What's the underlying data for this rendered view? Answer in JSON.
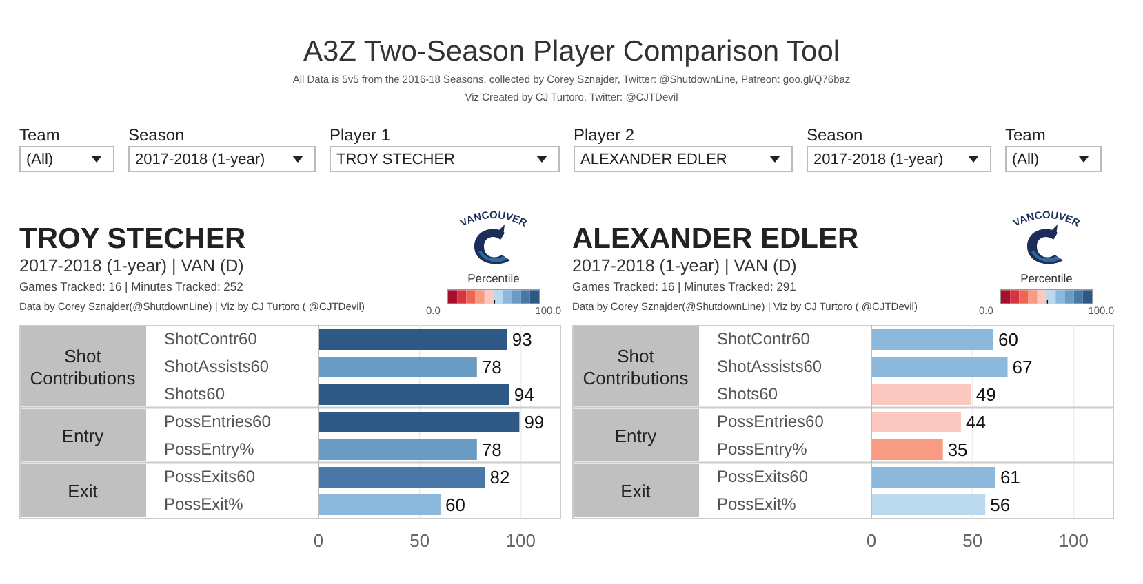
{
  "title": "A3Z Two-Season Player Comparison Tool",
  "subtitle_lines": [
    "All Data is 5v5 from the 2016-18 Seasons, collected by Corey Sznajder, Twitter: @ShutdownLine, Patreon: goo.gl/Q76baz",
    "Viz Created by CJ Turtoro, Twitter: @CJTDevil"
  ],
  "filters": [
    {
      "label": "Team",
      "value": "(All)"
    },
    {
      "label": "Season",
      "value": "2017-2018 (1-year)"
    },
    {
      "label": "Player 1",
      "value": "TROY STECHER"
    },
    {
      "label": "Player 2",
      "value": "ALEXANDER EDLER"
    },
    {
      "label": "Season",
      "value": "2017-2018 (1-year)"
    },
    {
      "label": "Team",
      "value": "(All)"
    }
  ],
  "panels": [
    {
      "player": "TROY STECHER",
      "season_team": "2017-2018 (1-year) | VAN (D)",
      "tracked": "Games Tracked: 16  | Minutes Tracked: 252",
      "credit": "Data by Corey Sznajder(@ShutdownLine) | Viz by CJ Turtoro ( @CJTDevil)",
      "logo_text": "VANCOUVER",
      "legend": {
        "title": "Percentile",
        "min_label": "0.0",
        "max_label": "100.0"
      },
      "groups": [
        {
          "label": "Shot Contributions",
          "rows": [
            "ShotContr60",
            "ShotAssists60",
            "Shots60"
          ]
        },
        {
          "label": "Entry",
          "rows": [
            "PossEntries60",
            "PossEntry%"
          ]
        },
        {
          "label": "Exit",
          "rows": [
            "PossExits60",
            "PossExit%"
          ]
        }
      ],
      "chart_data": {
        "type": "bar",
        "orientation": "horizontal",
        "values": [
          93,
          78,
          94,
          99,
          78,
          82,
          60
        ],
        "xlim": [
          0,
          120
        ],
        "xticks": [
          0,
          50,
          100
        ],
        "data_labels": true
      }
    },
    {
      "player": "ALEXANDER EDLER",
      "season_team": "2017-2018 (1-year) | VAN (D)",
      "tracked": "Games Tracked: 16  | Minutes Tracked: 291",
      "credit": "Data by Corey Sznajder(@ShutdownLine) | Viz by CJ Turtoro ( @CJTDevil)",
      "logo_text": "VANCOUVER",
      "legend": {
        "title": "Percentile",
        "min_label": "0.0",
        "max_label": "100.0"
      },
      "groups": [
        {
          "label": "Shot Contributions",
          "rows": [
            "ShotContr60",
            "ShotAssists60",
            "Shots60"
          ]
        },
        {
          "label": "Entry",
          "rows": [
            "PossEntries60",
            "PossEntry%"
          ]
        },
        {
          "label": "Exit",
          "rows": [
            "PossExits60",
            "PossExit%"
          ]
        }
      ],
      "chart_data": {
        "type": "bar",
        "orientation": "horizontal",
        "values": [
          60,
          67,
          49,
          44,
          35,
          61,
          56
        ],
        "xlim": [
          0,
          120
        ],
        "xticks": [
          0,
          50,
          100
        ],
        "data_labels": true
      }
    }
  ]
}
